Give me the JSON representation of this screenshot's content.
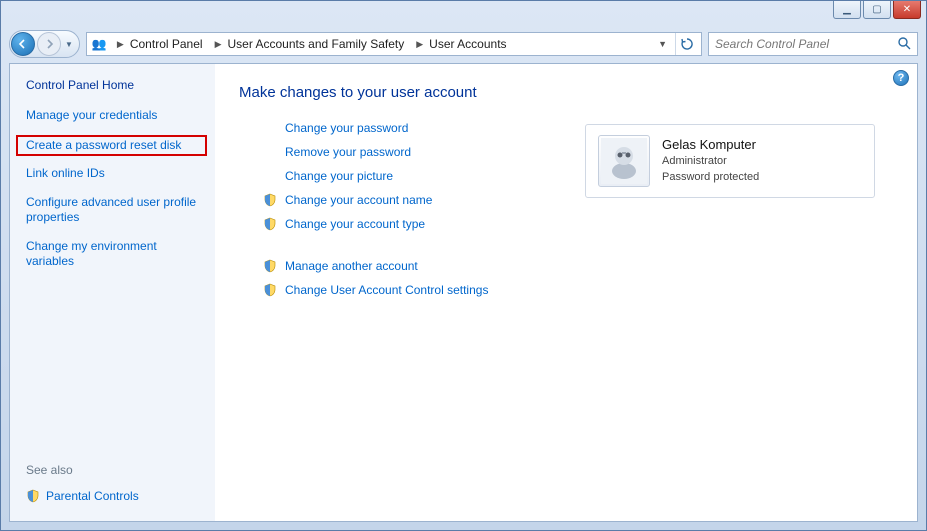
{
  "window_controls": {
    "min": "▁",
    "max": "▢",
    "close": "✕"
  },
  "breadcrumbs": {
    "icon": "👥",
    "items": [
      "Control Panel",
      "User Accounts and Family Safety",
      "User Accounts"
    ]
  },
  "search": {
    "placeholder": "Search Control Panel"
  },
  "sidebar": {
    "home": "Control Panel Home",
    "links": [
      "Manage your credentials",
      "Create a password reset disk",
      "Link online IDs",
      "Configure advanced user profile properties",
      "Change my environment variables"
    ],
    "highlight_index": 1,
    "seealso_title": "See also",
    "seealso_item": "Parental Controls"
  },
  "main": {
    "heading": "Make changes to your user account",
    "group1": [
      {
        "label": "Change your password",
        "shield": false
      },
      {
        "label": "Remove your password",
        "shield": false
      },
      {
        "label": "Change your picture",
        "shield": false
      },
      {
        "label": "Change your account name",
        "shield": true
      },
      {
        "label": "Change your account type",
        "shield": true
      }
    ],
    "group2": [
      {
        "label": "Manage another account",
        "shield": true
      },
      {
        "label": "Change User Account Control settings",
        "shield": true
      }
    ],
    "user": {
      "name": "Gelas Komputer",
      "role": "Administrator",
      "status": "Password protected"
    }
  }
}
